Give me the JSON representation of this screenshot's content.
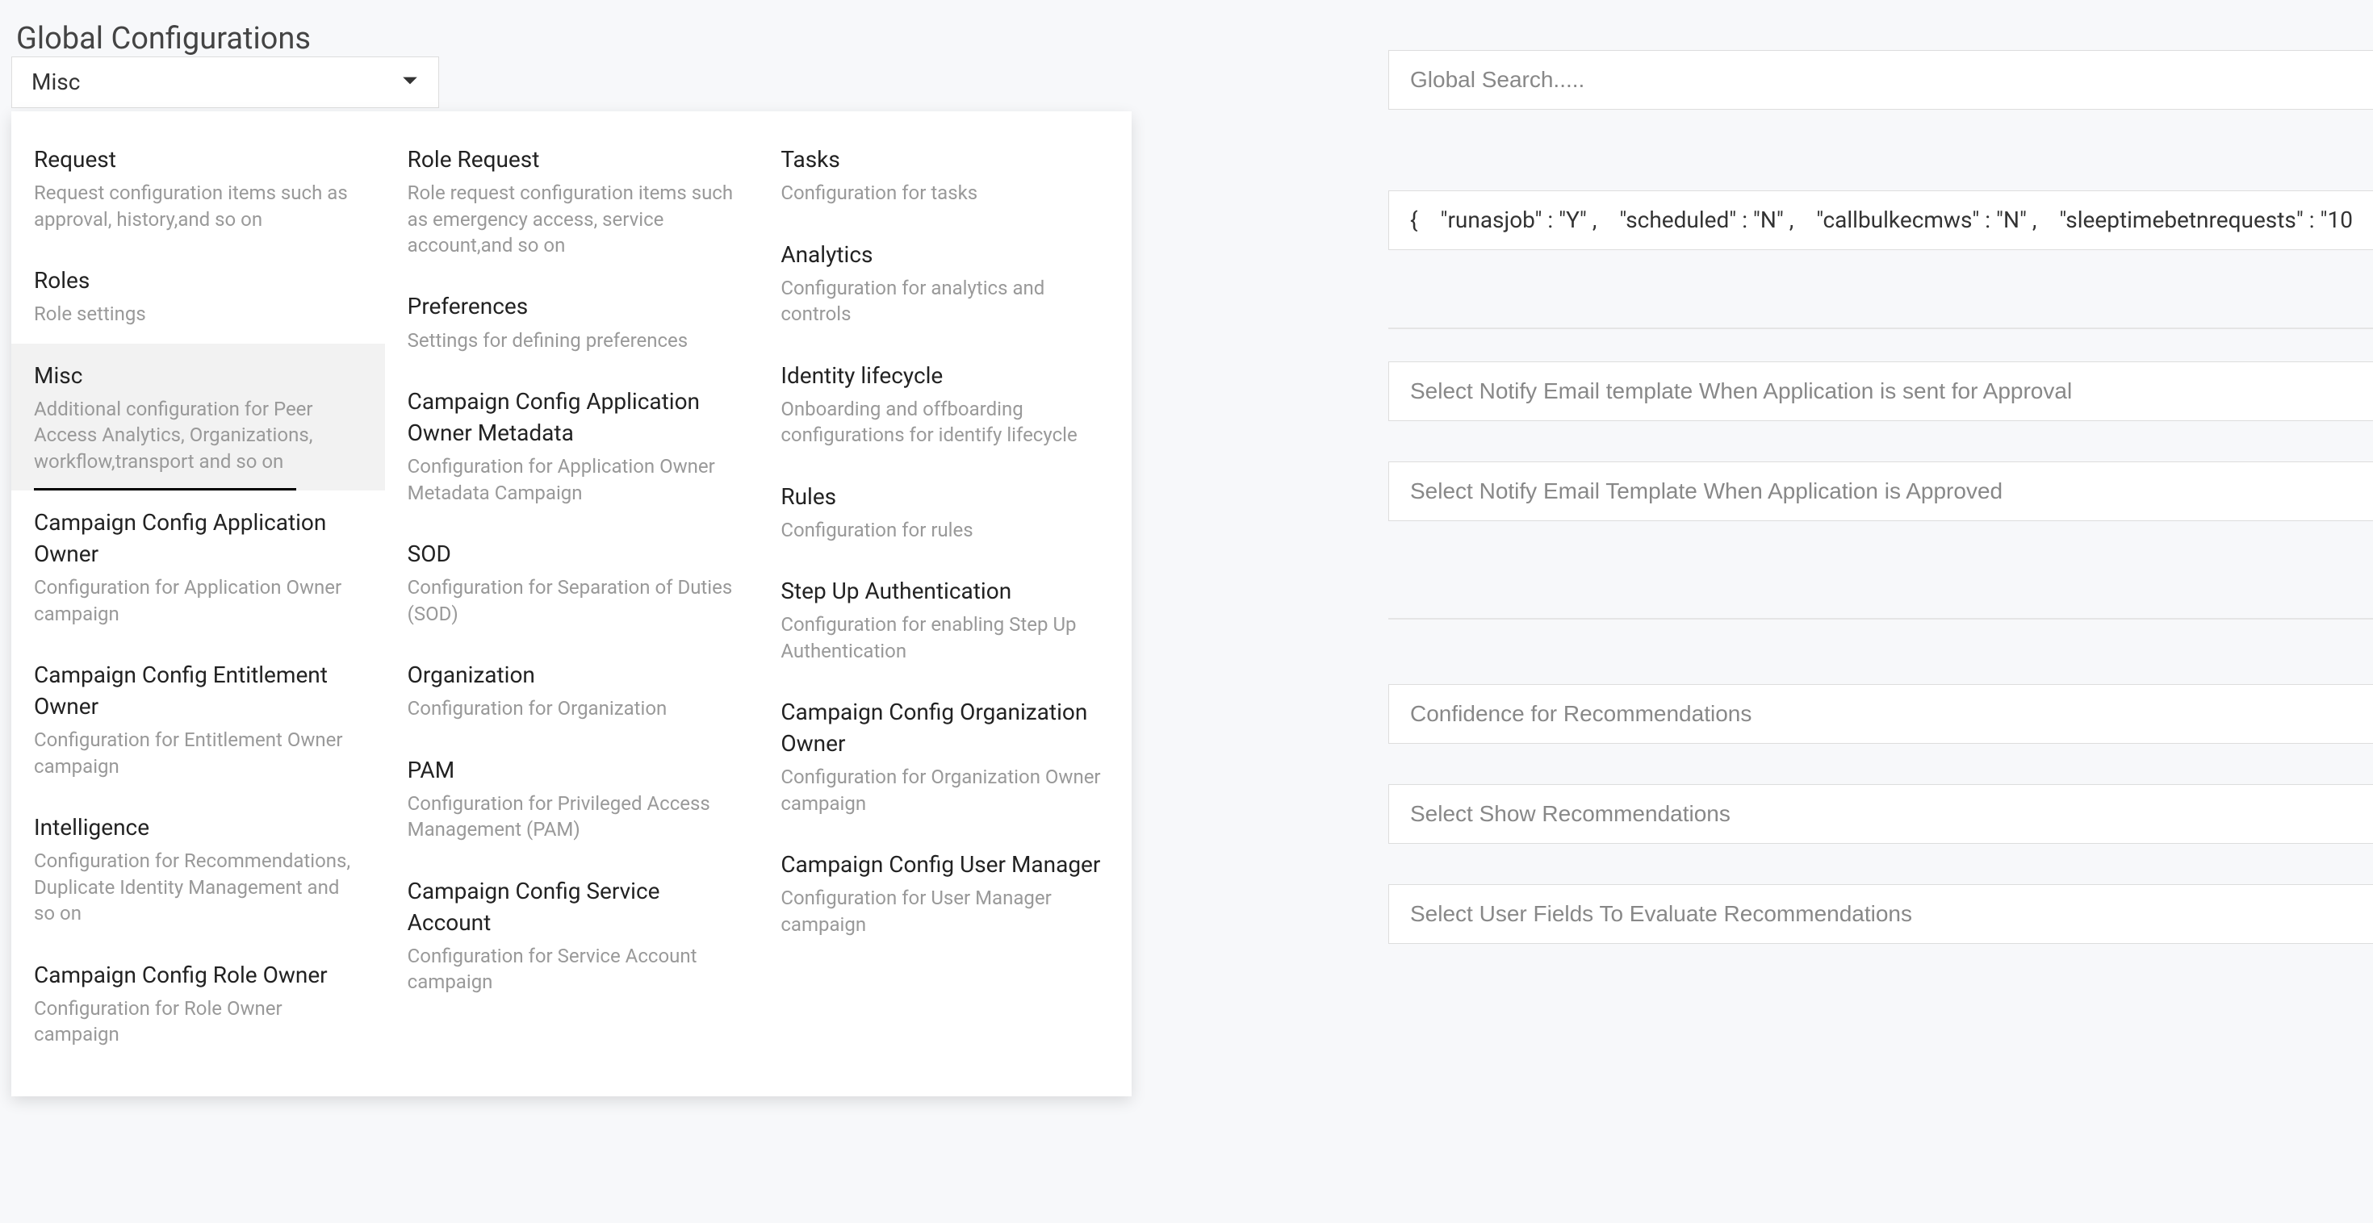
{
  "page_title": "Global Configurations",
  "dropdown_selected": "Misc",
  "search_placeholder": "Global Search.....",
  "json_value": "{　\"runasjob\" : \"Y\" ,　\"scheduled\" : \"N\" ,　\"callbulkecmws\" : \"N\" ,　\"sleeptimebetnrequests\" : \"10",
  "fields": {
    "notify_approval": "Select Notify Email template When Application is sent for Approval",
    "notify_approved": "Select Notify Email Template When Application is Approved",
    "confidence": "Confidence for Recommendations",
    "show_recs": "Select Show Recommendations",
    "user_fields": "Select User Fields To Evaluate Recommendations"
  },
  "dropdown": {
    "col1": [
      {
        "title": "Request",
        "desc": "Request configuration items such as approval, history,and so on"
      },
      {
        "title": "Roles",
        "desc": "Role settings"
      },
      {
        "title": "Misc",
        "desc": "Additional configuration for Peer Access Analytics, Organizations, workflow,transport and so on",
        "selected": true
      },
      {
        "title": "Campaign Config Application Owner",
        "desc": "Configuration for Application Owner campaign"
      },
      {
        "title": "Campaign Config Entitlement Owner",
        "desc": "Configuration for Entitlement Owner campaign"
      },
      {
        "title": "Intelligence",
        "desc": "Configuration for Recommendations, Duplicate Identity Management and so on"
      },
      {
        "title": "Campaign Config Role Owner",
        "desc": "Configuration for Role Owner campaign"
      }
    ],
    "col2": [
      {
        "title": "Role Request",
        "desc": "Role request configuration items such as emergency access, service account,and so on"
      },
      {
        "title": "Preferences",
        "desc": "Settings for defining preferences"
      },
      {
        "title": "Campaign Config Application Owner Metadata",
        "desc": "Configuration for Application Owner Metadata Campaign"
      },
      {
        "title": "SOD",
        "desc": "Configuration for Separation of Duties (SOD)"
      },
      {
        "title": "Organization",
        "desc": "Configuration for Organization"
      },
      {
        "title": "PAM",
        "desc": "Configuration for Privileged Access Management (PAM)"
      },
      {
        "title": "Campaign Config Service Account",
        "desc": "Configuration for Service Account campaign"
      }
    ],
    "col3": [
      {
        "title": "Tasks",
        "desc": "Configuration for tasks"
      },
      {
        "title": "Analytics",
        "desc": "Configuration for analytics and controls"
      },
      {
        "title": "Identity lifecycle",
        "desc": "Onboarding and offboarding configurations for identify lifecycle"
      },
      {
        "title": "Rules",
        "desc": "Configuration for rules"
      },
      {
        "title": "Step Up Authentication",
        "desc": "Configuration for enabling Step Up Authentication"
      },
      {
        "title": "Campaign Config Organization Owner",
        "desc": "Configuration for Organization Owner campaign"
      },
      {
        "title": "Campaign Config User Manager",
        "desc": "Configuration for User Manager campaign"
      }
    ]
  }
}
